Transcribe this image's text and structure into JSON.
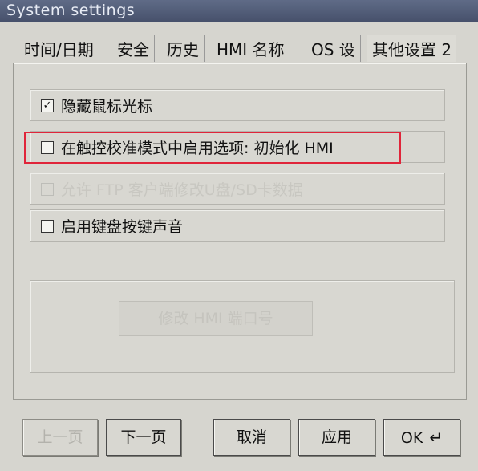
{
  "window": {
    "title": "System settings"
  },
  "tabs": [
    {
      "label": "时间/日期",
      "active": false
    },
    {
      "label": "安全",
      "active": false
    },
    {
      "label": "历史",
      "active": false
    },
    {
      "label": "HMI 名称",
      "active": false
    },
    {
      "label": "OS 设",
      "active": false
    },
    {
      "label": "其他设置 2",
      "active": true
    }
  ],
  "options": [
    {
      "label": "隐藏鼠标光标",
      "checked": true,
      "enabled": true
    },
    {
      "label": "在触控校准模式中启用选项: 初始化 HMI",
      "checked": false,
      "enabled": true,
      "highlighted": true
    },
    {
      "label": "允许 FTP 客户端修改U盘/SD卡数据",
      "checked": false,
      "enabled": false
    },
    {
      "label": "启用键盘按键声音",
      "checked": false,
      "enabled": true
    }
  ],
  "port_button": {
    "label": "修改 HMI 端口号",
    "enabled": false
  },
  "footer": {
    "prev": "上一页",
    "next": "下一页",
    "cancel": "取消",
    "apply": "应用",
    "ok": "OK",
    "ok_icon": "enter-icon"
  },
  "colors": {
    "highlight": "#e0253a",
    "titlebar": "#4f5a75"
  }
}
